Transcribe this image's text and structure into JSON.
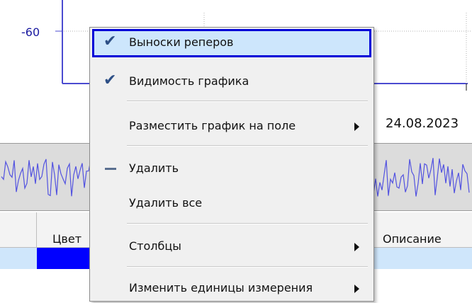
{
  "chart": {
    "y_tick_label": "-60",
    "date_label": "24.08.2023"
  },
  "table": {
    "headers": [
      "Цвет",
      "Описание"
    ],
    "row_color": "#0000ff"
  },
  "context_menu": {
    "items": [
      {
        "label": "Выноски реперов",
        "mark": "check",
        "selected": true,
        "submenu": false
      },
      {
        "label": "Видимость графика",
        "mark": "check",
        "selected": false,
        "submenu": false
      },
      {
        "label": "Разместить график на поле",
        "mark": "none",
        "selected": false,
        "submenu": true
      },
      {
        "label": "Удалить",
        "mark": "dash",
        "selected": false,
        "submenu": false
      },
      {
        "label": "Удалить все",
        "mark": "none",
        "selected": false,
        "submenu": false
      },
      {
        "label": "Столбцы",
        "mark": "none",
        "selected": false,
        "submenu": true
      },
      {
        "label": "Изменить единицы измерения",
        "mark": "none",
        "selected": false,
        "submenu": true
      }
    ]
  },
  "colors": {
    "highlight_border": "#0000d8",
    "highlight_fill": "#cde6fc",
    "waveform": "#5252e0",
    "axis": "#4b4bd0"
  }
}
